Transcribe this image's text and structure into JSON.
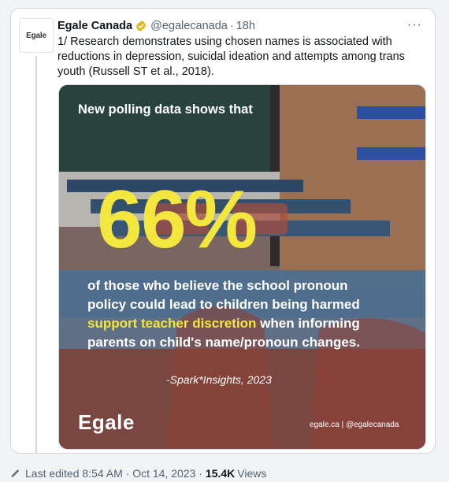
{
  "tweet": {
    "avatar_text": "Egale",
    "display_name": "Egale Canada",
    "handle": "@egalecanada",
    "separator": "·",
    "time": "18h",
    "more_icon": "more-horizontal-icon",
    "text": "1/ Research demonstrates using chosen names is associated with reductions in depression, suicidal ideation and attempts among trans youth (Russell ST et al., 2018).",
    "media": {
      "lead": "New polling data shows that",
      "big_stat": "66%",
      "line1": "of those who believe the school pronoun",
      "line2": "policy could lead to children being harmed",
      "highlight": "support teacher discretion",
      "line3_rest": " when informing",
      "line4": "parents on child's name/pronoun changes.",
      "citation": "-Spark*Insights, 2023",
      "logo": "Egale",
      "footer_handle": "egale.ca | @egalecanada"
    }
  },
  "meta": {
    "edit_icon": "pencil-icon",
    "edited_text": "Last edited 8:54 AM · Oct 14, 2023 ·",
    "views_count": "15.4K",
    "views_label": "Views"
  },
  "colors": {
    "accent_yellow": "#f2e63f",
    "accent_blue": "#2a4fa3",
    "verified_gold": "#e2b719"
  }
}
